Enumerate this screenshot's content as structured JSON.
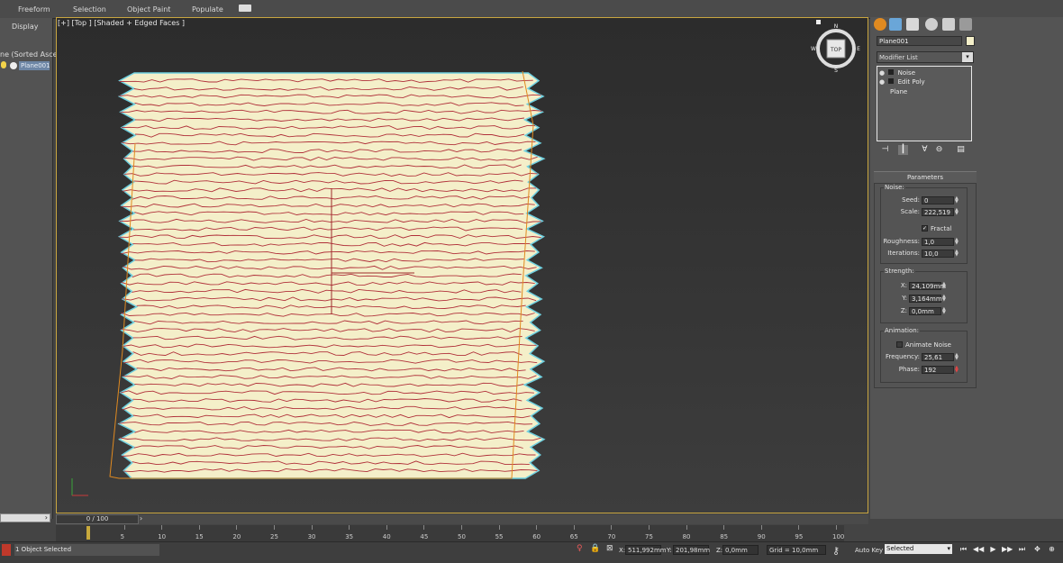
{
  "ribbon": {
    "tabs": [
      "Freeform",
      "Selection",
      "Object Paint",
      "Populate"
    ]
  },
  "left_panel": {
    "display_label": "Display",
    "sort_label": "ne (Sorted Ascend",
    "item_label": "Plane001"
  },
  "viewport": {
    "label": "[+] [Top ] [Shaded + Edged Faces ]",
    "viewcube_label": "TOP",
    "compass": [
      "N",
      "S",
      "E",
      "W"
    ],
    "object_color": "#f4efc9",
    "line_color": "#b0303a",
    "outline_color": "#6fd0e0",
    "selection_color": "#e08a20"
  },
  "command_panel": {
    "object_name": "Plane001",
    "modifier_list": "Modifier List",
    "stack": [
      "Noise",
      "Edit Poly",
      "Plane"
    ],
    "rollout_title": "Parameters",
    "noise": {
      "group": "Noise:",
      "seed_label": "Seed:",
      "seed": "0",
      "scale_label": "Scale:",
      "scale": "222,519",
      "fractal_label": "Fractal",
      "roughness_label": "Roughness:",
      "roughness": "1,0",
      "iterations_label": "Iterations:",
      "iterations": "10,0"
    },
    "strength": {
      "group": "Strength:",
      "x_label": "X:",
      "x": "24,109mm",
      "y_label": "Y:",
      "y": "3,164mm",
      "z_label": "Z:",
      "z": "0,0mm"
    },
    "animation": {
      "group": "Animation:",
      "animate_label": "Animate Noise",
      "frequency_label": "Frequency:",
      "frequency": "25,61",
      "phase_label": "Phase:",
      "phase": "192"
    }
  },
  "timeline": {
    "slider_label": "0 / 100",
    "ticks": [
      "5",
      "10",
      "15",
      "20",
      "25",
      "30",
      "35",
      "40",
      "45",
      "50",
      "55",
      "60",
      "65",
      "70",
      "75",
      "80",
      "85",
      "90",
      "95",
      "100"
    ]
  },
  "status": {
    "selection_text": "1 Object Selected",
    "x_label": "X:",
    "x": "511,992mm",
    "y_label": "Y:",
    "y": "201,98mm",
    "z_label": "Z:",
    "z": "0,0mm",
    "grid": "Grid = 10,0mm",
    "auto_key": "Auto Key",
    "selected_dropdown": "Selected"
  }
}
